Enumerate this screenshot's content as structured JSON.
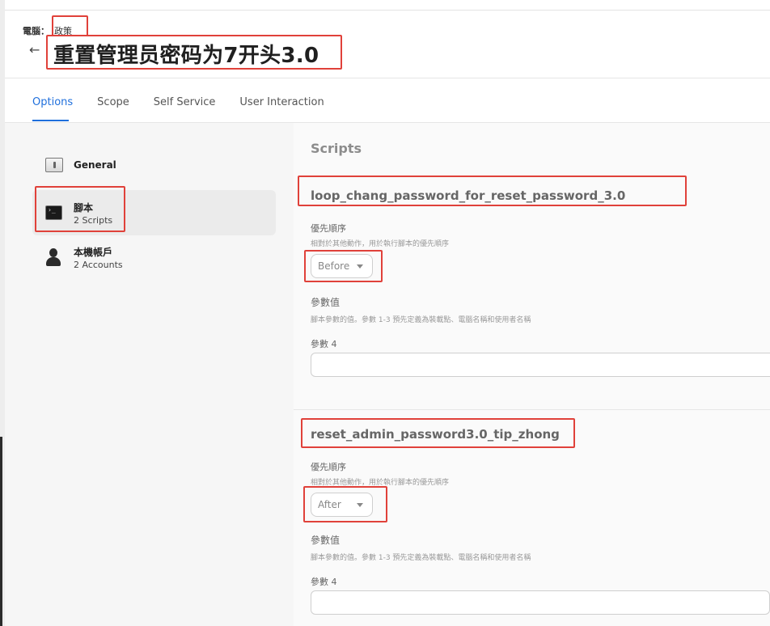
{
  "breadcrumb": {
    "parent": "電腦：",
    "current": "政策"
  },
  "page": {
    "back_glyph": "←",
    "title": "重置管理员密码为7开头3.0"
  },
  "tabs": [
    {
      "label": "Options",
      "active": true
    },
    {
      "label": "Scope",
      "active": false
    },
    {
      "label": "Self Service",
      "active": false
    },
    {
      "label": "User Interaction",
      "active": false
    }
  ],
  "sidebar": {
    "items": [
      {
        "label": "General",
        "sub": "",
        "icon": "general-icon",
        "active": false
      },
      {
        "label": "腳本",
        "sub": "2 Scripts",
        "icon": "terminal-icon",
        "active": true
      },
      {
        "label": "本機帳戶",
        "sub": "2 Accounts",
        "icon": "user-icon",
        "active": false
      }
    ]
  },
  "content": {
    "section_title": "Scripts",
    "scripts": [
      {
        "name": "loop_chang_password_for_reset_password_3.0",
        "priority_label": "優先順序",
        "priority_desc": "相對於其他動作，用於執行腳本的優先順序",
        "priority_value": "Before",
        "params_label": "參數值",
        "params_desc": "腳本參數的值。參數 1-3 預先定義為裝載點、電腦名稱和使用者名稱",
        "param4_label": "參數 4",
        "param4_value": ""
      },
      {
        "name": "reset_admin_password3.0_tip_zhong",
        "priority_label": "優先順序",
        "priority_desc": "相對於其他動作，用於執行腳本的優先順序",
        "priority_value": "After",
        "params_label": "參數值",
        "params_desc": "腳本參數的值。參數 1-3 預先定義為裝載點、電腦名稱和使用者名稱",
        "param4_label": "參數 4",
        "param4_value": ""
      }
    ]
  },
  "colors": {
    "accent": "#1f6fdc",
    "highlight": "#e0413a"
  }
}
